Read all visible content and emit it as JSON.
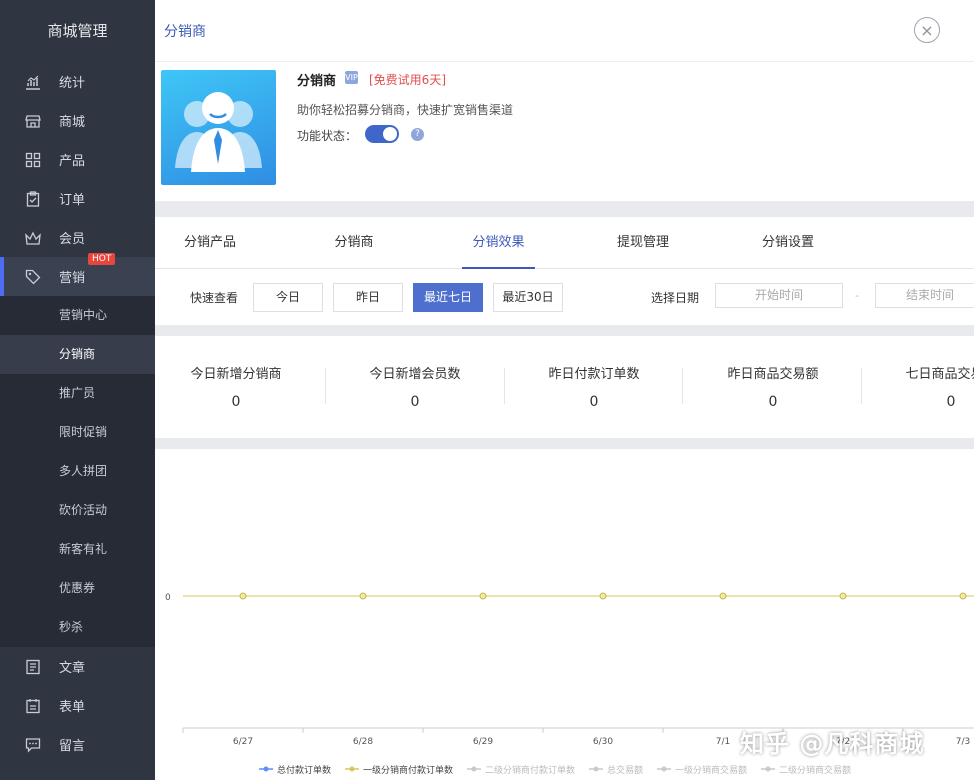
{
  "sidebar": {
    "title": "商城管理",
    "items": [
      {
        "label": "统计",
        "icon": "chart-icon"
      },
      {
        "label": "商城",
        "icon": "store-icon"
      },
      {
        "label": "产品",
        "icon": "grid-icon"
      },
      {
        "label": "订单",
        "icon": "clipboard-icon"
      },
      {
        "label": "会员",
        "icon": "crown-icon"
      },
      {
        "label": "营销",
        "icon": "tag-icon",
        "badge": "HOT"
      }
    ],
    "sub_items": [
      "营销中心",
      "分销商",
      "推广员",
      "限时促销",
      "多人拼团",
      "砍价活动",
      "新客有礼",
      "优惠券",
      "秒杀"
    ],
    "bottom_items": [
      {
        "label": "文章",
        "icon": "article-icon"
      },
      {
        "label": "表单",
        "icon": "form-icon"
      },
      {
        "label": "留言",
        "icon": "message-icon"
      }
    ]
  },
  "header": {
    "title": "分销商",
    "close": "×"
  },
  "plugin": {
    "name": "分销商",
    "vip": "VIP",
    "trial": "[免费试用6天]",
    "description": "助你轻松招募分销商，快速扩宽销售渠道",
    "status_label": "功能状态：",
    "help": "?"
  },
  "tabs": [
    "分销产品",
    "分销商",
    "分销效果",
    "提现管理",
    "分销设置"
  ],
  "filter": {
    "quick_label": "快速查看",
    "buttons": [
      "今日",
      "昨日",
      "最近七日",
      "最近30日"
    ],
    "date_label": "选择日期",
    "start_placeholder": "开始时间",
    "separator": "-",
    "end_placeholder": "结束时间"
  },
  "stats": [
    {
      "title": "今日新增分销商",
      "value": "0"
    },
    {
      "title": "今日新增会员数",
      "value": "0"
    },
    {
      "title": "昨日付款订单数",
      "value": "0"
    },
    {
      "title": "昨日商品交易额",
      "value": "0"
    },
    {
      "title": "七日商品交易额",
      "value": "0"
    }
  ],
  "chart_data": {
    "type": "line",
    "categories": [
      "6/27",
      "6/28",
      "6/29",
      "6/30",
      "7/1",
      "7/2",
      "7/3"
    ],
    "y_tick": "0",
    "series": [
      {
        "name": "总付款订单数",
        "values": [
          0,
          0,
          0,
          0,
          0,
          0,
          0
        ],
        "color": "#5b8ff9"
      },
      {
        "name": "一级分销商付款订单数",
        "values": [
          0,
          0,
          0,
          0,
          0,
          0,
          0
        ],
        "color": "#d9c75a"
      },
      {
        "name": "二级分销商付款订单数",
        "values": [
          0,
          0,
          0,
          0,
          0,
          0,
          0
        ],
        "color": "#c9c9c9"
      },
      {
        "name": "总交易额",
        "values": [
          0,
          0,
          0,
          0,
          0,
          0,
          0
        ],
        "color": "#c9c9c9"
      },
      {
        "name": "一级分销商交易额",
        "values": [
          0,
          0,
          0,
          0,
          0,
          0,
          0
        ],
        "color": "#c9c9c9"
      },
      {
        "name": "二级分销商交易额",
        "values": [
          0,
          0,
          0,
          0,
          0,
          0,
          0
        ],
        "color": "#c9c9c9"
      }
    ]
  },
  "watermark": "知乎 @凡科商城"
}
